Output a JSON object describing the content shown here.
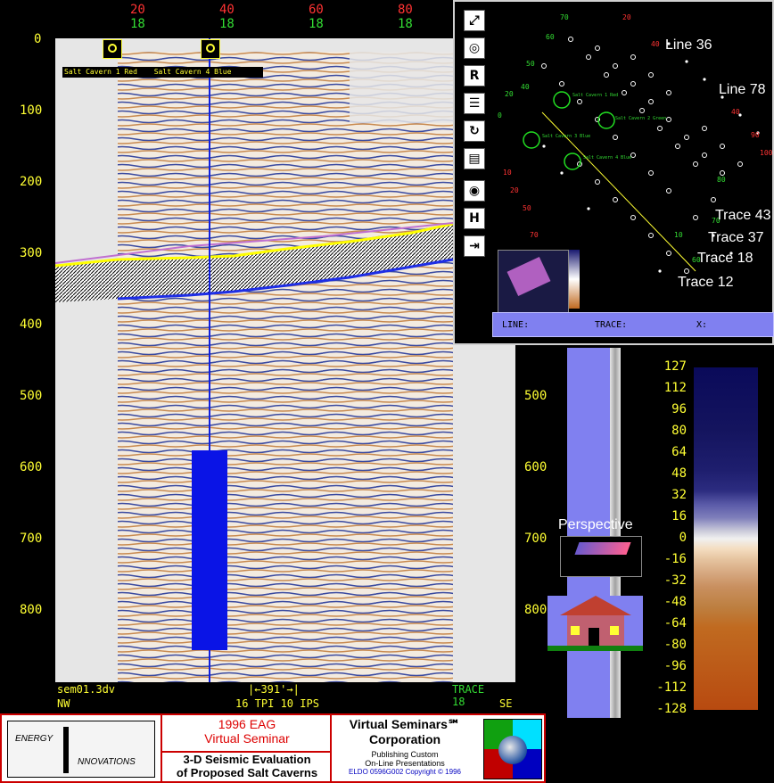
{
  "section": {
    "top_traces": [
      {
        "red": "20",
        "green": "18"
      },
      {
        "red": "40",
        "green": "18"
      },
      {
        "red": "60",
        "green": "18"
      },
      {
        "red": "80",
        "green": "18"
      }
    ],
    "left_depths": [
      "0",
      "100",
      "200",
      "300",
      "400",
      "500",
      "600",
      "700",
      "800"
    ],
    "right_depths": [
      "500",
      "600",
      "700",
      "800"
    ],
    "legend_red": "Salt Cavern 1 Red",
    "legend_blue": "Salt Cavern 4 Blue",
    "filename": "sem01.3dv",
    "scale_label": "391'",
    "tpi_label": "16 TPI 10 IPS",
    "trace_label": "TRACE 18",
    "dir_left": "NW",
    "dir_right": "SE"
  },
  "map": {
    "line_labels": [
      "Line 36",
      "Line 78"
    ],
    "trace_labels": [
      "Trace 43",
      "Trace 37",
      "Trace 18",
      "Trace 12"
    ],
    "cavern_labels": [
      "Salt Cavern 1 Red",
      "Salt Cavern 2 Green",
      "Salt Cavern 3 Blue",
      "Salt Cavern 4 Blue"
    ],
    "status_fields": [
      "LINE:",
      "TRACE:",
      "X:"
    ]
  },
  "tools": [
    "zoom-tool",
    "pick-tool",
    "R",
    "layers-tool",
    "rotate-tool",
    "notes-tool",
    "contour-tool",
    "H",
    "export-tool"
  ],
  "perspective_label": "Perspective",
  "colorbar": {
    "ticks": [
      "127",
      "112",
      "96",
      "80",
      "64",
      "48",
      "32",
      "16",
      "0",
      "-16",
      "-32",
      "-48",
      "-64",
      "-80",
      "-96",
      "-112",
      "-128"
    ],
    "colors": [
      "#0a0a5a",
      "#14145e",
      "#1e1e6e",
      "#2c2c80",
      "#3a3a92",
      "#5a5aa8",
      "#8080bb",
      "#a8a8cc",
      "#cfcfdc",
      "#f0f0f0",
      "#f4ddc0",
      "#e6c4a0",
      "#d6a880",
      "#c99060",
      "#bd7f40",
      "#c06a20",
      "#b84a10"
    ]
  },
  "banner": {
    "logo_line1": "ENERGY",
    "logo_line2": "NNOVATIONS",
    "event_line1": "1996 EAG",
    "event_line2": "Virtual Seminar",
    "title_line1": "3-D Seismic Evaluation",
    "title_line2": "of Proposed Salt Caverns",
    "company_line1": "Virtual Seminars℠",
    "company_line2": "Corporation",
    "tagline1": "Publishing Custom",
    "tagline2": "On-Line Presentations",
    "copyright": "ELDO 0596G002 Copyright © 1996"
  },
  "colors": {
    "axis_yellow": "#ffff33",
    "trace_green": "#33dd33",
    "trace_red": "#ff3333",
    "well_blue": "#0a14e6",
    "panel_blue": "#8080f0"
  }
}
